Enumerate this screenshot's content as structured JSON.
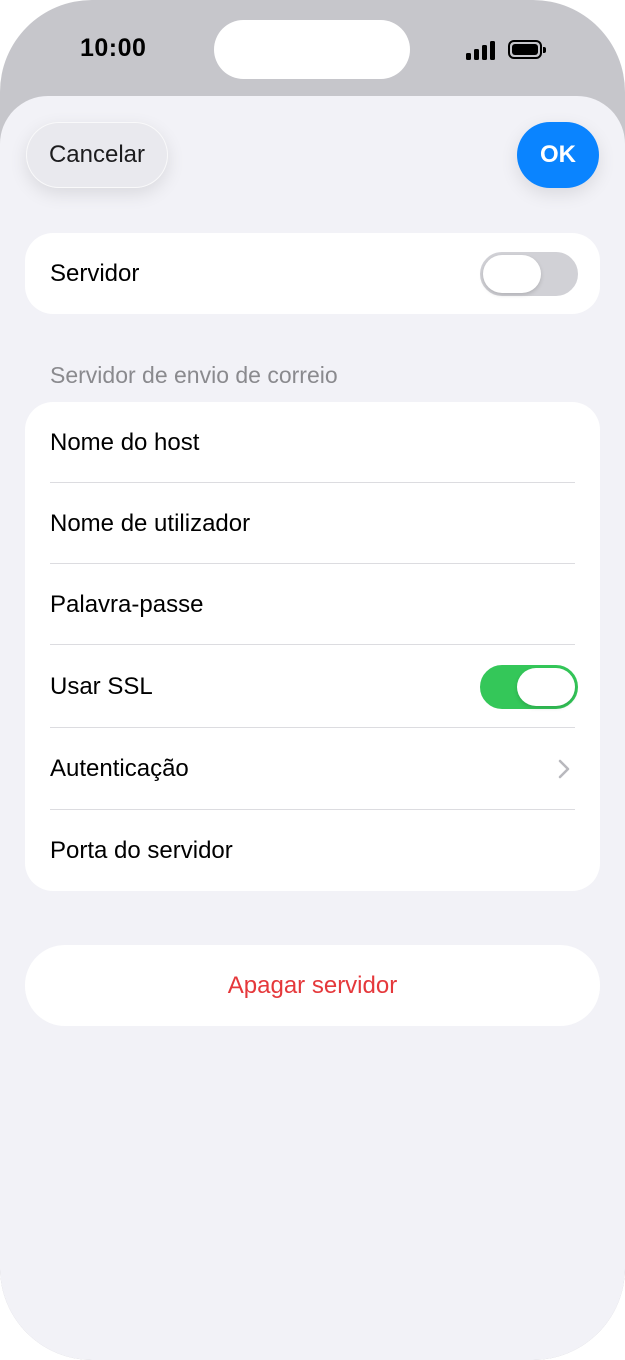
{
  "status_bar": {
    "time": "10:00",
    "signal_icon": "cellular-signal-icon",
    "battery_icon": "battery-icon"
  },
  "nav": {
    "cancel_label": "Cancelar",
    "ok_label": "OK"
  },
  "server_card": {
    "label": "Servidor",
    "toggle_on": false
  },
  "outgoing_section": {
    "header": "Servidor de envio de correio",
    "rows": [
      {
        "label": "Nome do host"
      },
      {
        "label": "Nome de utilizador"
      },
      {
        "label": "Palavra-passe"
      },
      {
        "label": "Usar SSL",
        "toggle_on": true
      },
      {
        "label": "Autenticação",
        "icon": "chevron-right-icon"
      },
      {
        "label": "Porta do servidor"
      }
    ]
  },
  "delete_label": "Apagar servidor",
  "colors": {
    "accent": "#0a84ff",
    "toggle_on": "#34c759",
    "toggle_off": "#d1d1d6",
    "destructive": "#e5383b",
    "background": "#f2f2f7"
  }
}
